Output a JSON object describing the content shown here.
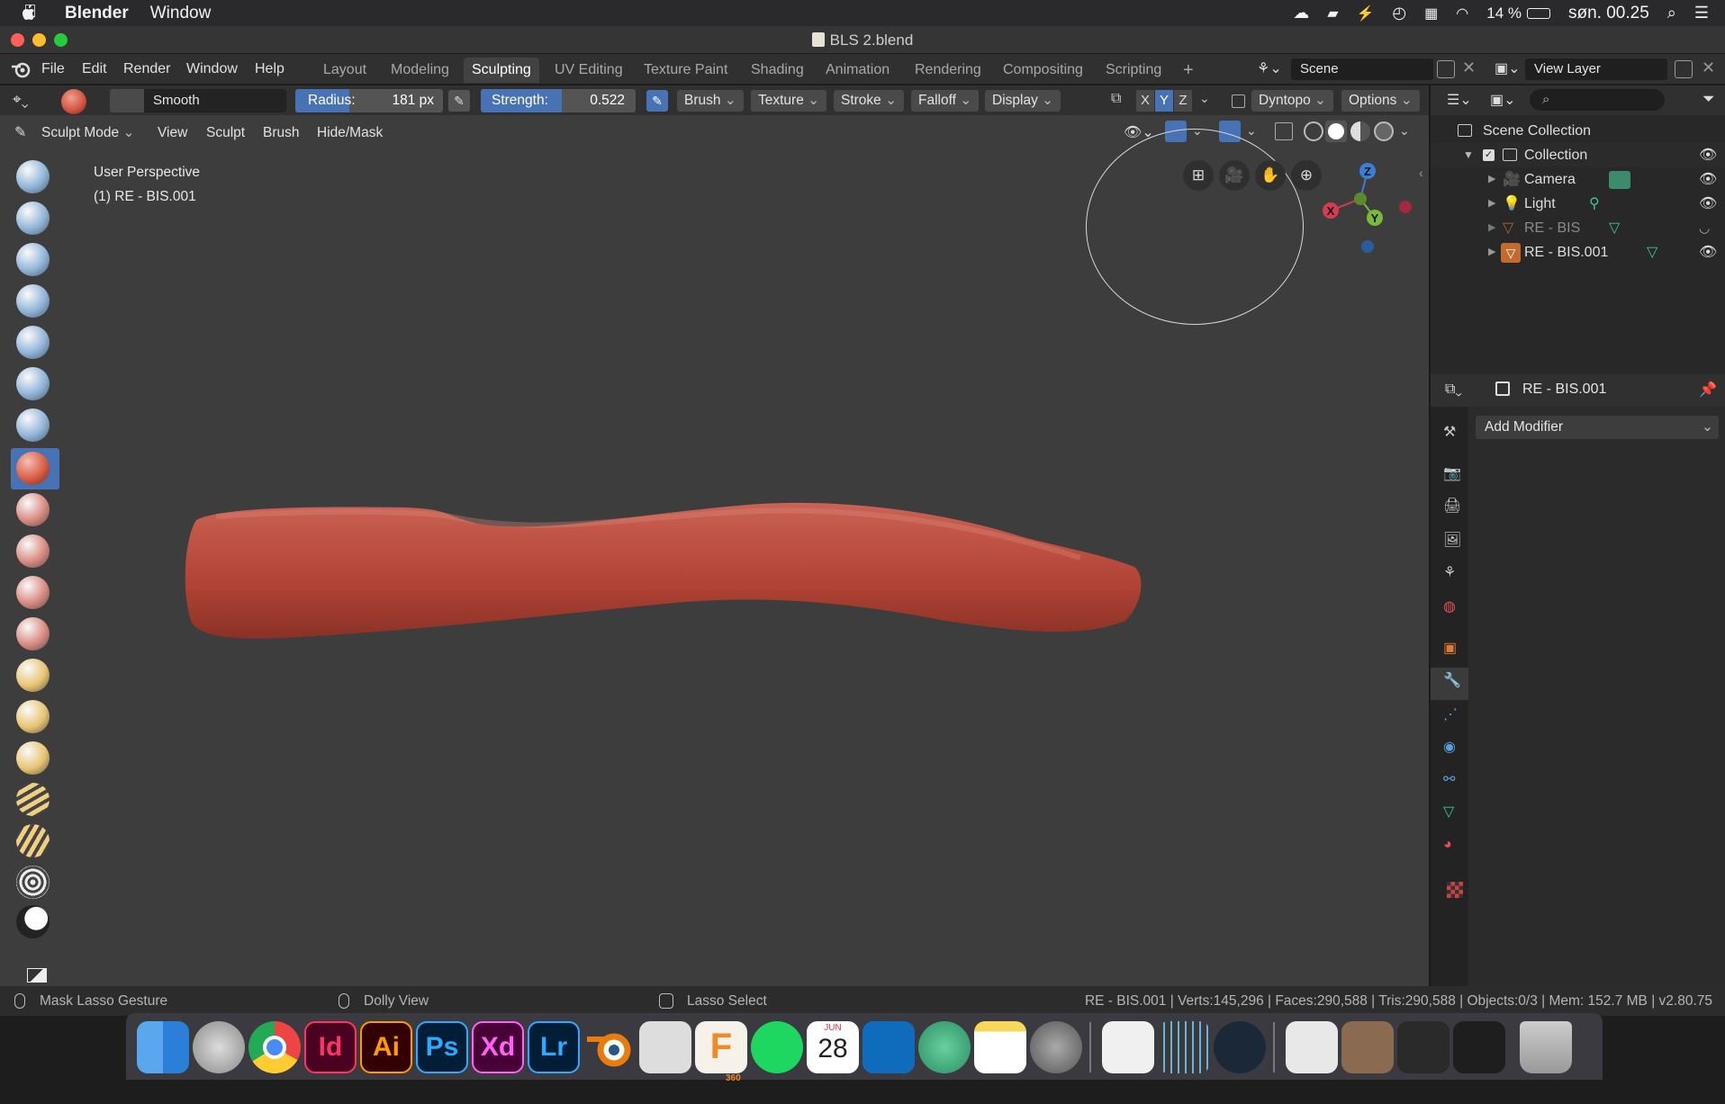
{
  "mac_menubar": {
    "app_name": "Blender",
    "menu_window": "Window",
    "battery": "14 %",
    "clock": "søn. 00.25"
  },
  "window": {
    "title": "BLS 2.blend"
  },
  "topbar": {
    "menus": [
      "File",
      "Edit",
      "Render",
      "Window",
      "Help"
    ],
    "workspaces": [
      "Layout",
      "Modeling",
      "Sculpting",
      "UV Editing",
      "Texture Paint",
      "Shading",
      "Animation",
      "Rendering",
      "Compositing",
      "Scripting"
    ],
    "active_workspace": "Sculpting",
    "add_workspace": "+",
    "scene_label": "Scene",
    "view_layer_label": "View Layer"
  },
  "tool_header": {
    "brush_name": "Smooth",
    "radius_label": "Radius:",
    "radius_value": "181 px",
    "strength_label": "Strength:",
    "strength_value": "0.522",
    "strength_fraction": 0.522,
    "dropdowns": [
      "Brush",
      "Texture",
      "Stroke",
      "Falloff",
      "Display"
    ],
    "axis_x": "X",
    "axis_y": "Y",
    "axis_z": "Z",
    "dyntopo_label": "Dyntopo",
    "options_label": "Options"
  },
  "mode_header": {
    "mode": "Sculpt Mode",
    "menus": [
      "View",
      "Sculpt",
      "Brush",
      "Hide/Mask"
    ]
  },
  "viewport": {
    "perspective": "User Perspective",
    "object_label": "(1) RE - BIS.001",
    "gizmo_x": "X",
    "gizmo_y": "Y",
    "gizmo_z": "Z"
  },
  "outliner": {
    "root": "Scene Collection",
    "collection": "Collection",
    "items": [
      "Camera",
      "Light",
      "RE - BIS",
      "RE - BIS.001"
    ]
  },
  "properties": {
    "object_name": "RE - BIS.001",
    "add_modifier": "Add Modifier"
  },
  "statusbar": {
    "left_hint": "Mask Lasso Gesture",
    "middle_hint": "Dolly View",
    "right_hint": "Lasso Select",
    "stats": "RE - BIS.001 | Verts:145,296 | Faces:290,588 | Tris:290,588 | Objects:0/3 | Mem: 152.7 MB | v2.80.75"
  },
  "dock": {
    "apps": [
      "Finder",
      "Launchpad",
      "Chrome",
      "InDesign",
      "Illustrator",
      "Photoshop",
      "XD",
      "Lightroom",
      "Blender",
      "Preview",
      "Fusion 360",
      "Spotify",
      "Calendar",
      "Outlook",
      "Atom",
      "Notes",
      "System Preferences",
      "TextEdit",
      "Audio",
      "Steam",
      "Window 1",
      "Window 2",
      "Window 3",
      "Window 4",
      "Trash"
    ],
    "adobe_id": "Id",
    "adobe_ai": "Ai",
    "adobe_ps": "Ps",
    "adobe_xd": "Xd",
    "adobe_lr": "Lr",
    "calendar_month": "JUN",
    "calendar_day": "28",
    "fusion_badge": "360"
  },
  "colors": {
    "accent_blue": "#4772b3",
    "object_red": "#b8473a",
    "viewport_bg": "#3d3d3d"
  }
}
